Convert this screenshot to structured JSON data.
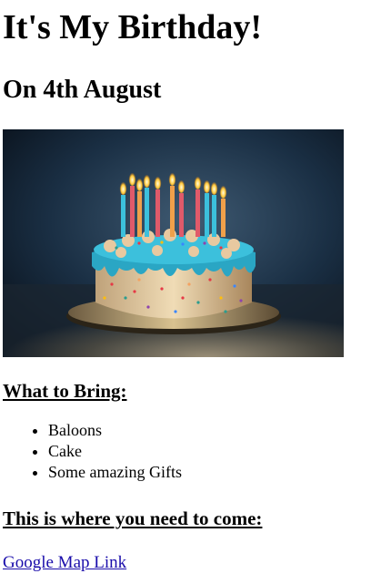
{
  "page": {
    "title": "It's My Birthday!",
    "subtitle": "On 4th August"
  },
  "image": {
    "icon": "birthday-cake-photo"
  },
  "bring": {
    "heading": "What to Bring:",
    "items": [
      "Baloons",
      "Cake",
      "Some amazing Gifts"
    ]
  },
  "location": {
    "heading": "This is where you need to come:",
    "link_text": "Google Map Link"
  },
  "colors": {
    "link": "#1a0dab",
    "frosting": "#2aa6c4",
    "background_dark": "#0f1f2e"
  }
}
